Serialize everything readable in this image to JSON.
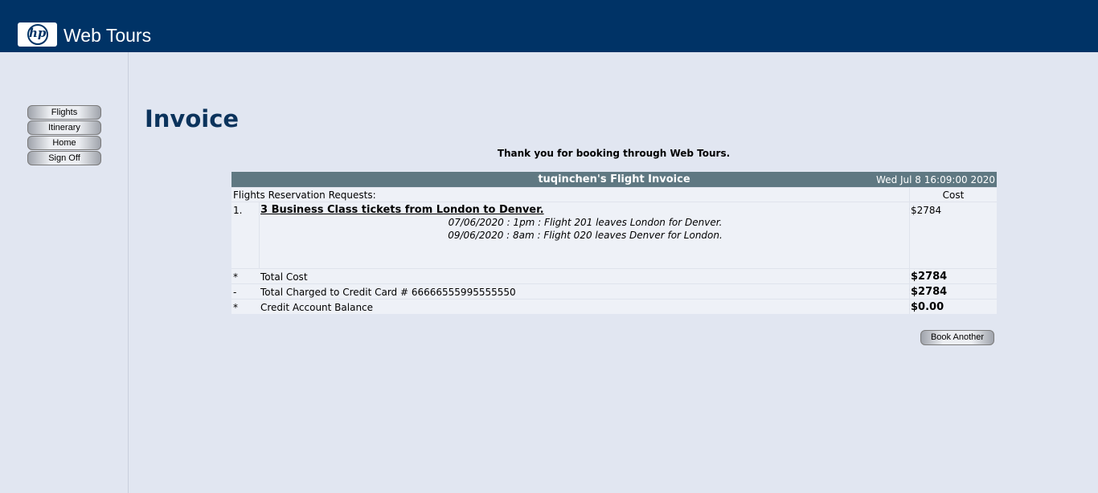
{
  "header": {
    "logo_text": "hp",
    "brand": "Web Tours"
  },
  "sidebar": {
    "items": [
      {
        "label": "Flights"
      },
      {
        "label": "Itinerary"
      },
      {
        "label": "Home"
      },
      {
        "label": "Sign Off"
      }
    ]
  },
  "main": {
    "title": "Invoice",
    "thanks": "Thank you for booking through Web Tours.",
    "invoice": {
      "title": "tuqinchen's Flight Invoice",
      "date": "Wed Jul 8 16:09:00 2020",
      "requests_label": "Flights Reservation Requests:",
      "cost_label": "Cost",
      "item": {
        "number": "1.",
        "title": "3 Business Class tickets from London to Denver.",
        "cost": "$2784",
        "flights": [
          "07/06/2020 : 1pm : Flight 201 leaves London for Denver.",
          "09/06/2020 : 8am : Flight 020 leaves Denver for London."
        ]
      },
      "summary": [
        {
          "marker": "*",
          "label": "Total Cost",
          "value": "$2784"
        },
        {
          "marker": "-",
          "label": "Total Charged to Credit Card # 66666555995555550",
          "value": "$2784"
        },
        {
          "marker": "*",
          "label": "Credit Account Balance",
          "value": "$0.00"
        }
      ]
    },
    "book_another": "Book Another"
  },
  "colors": {
    "header_bg": "#003366",
    "page_bg": "#e1e6f1",
    "invoice_header_bg": "#5f7882",
    "title_color": "#0b335c"
  }
}
